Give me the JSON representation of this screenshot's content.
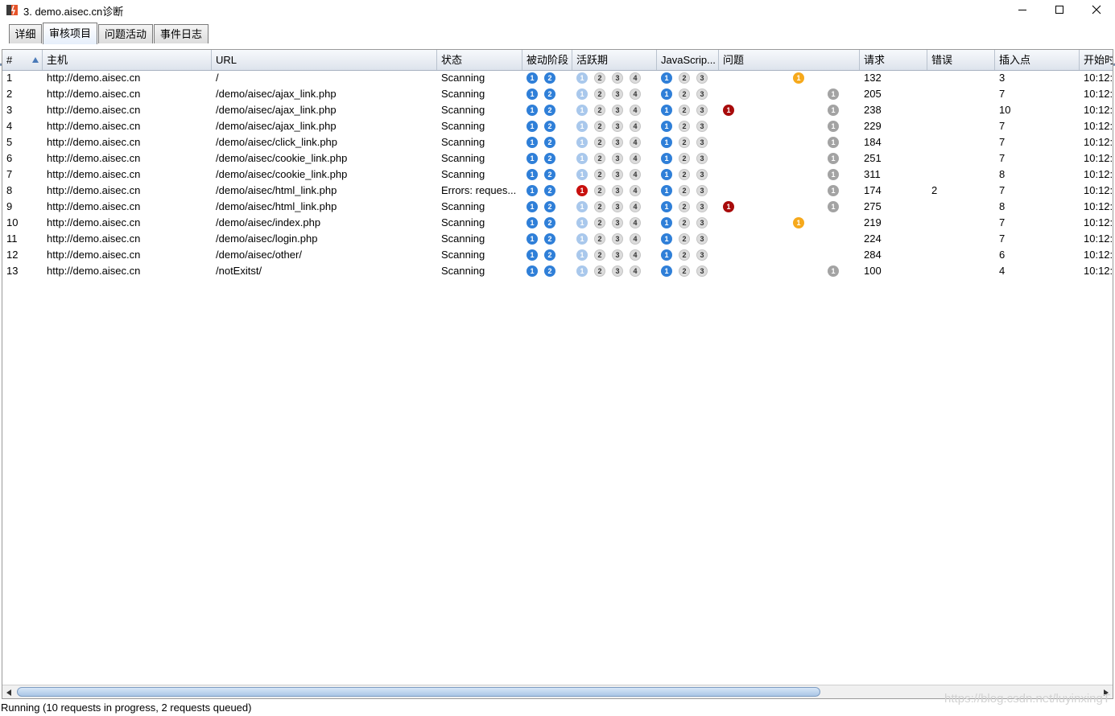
{
  "window": {
    "title": "3. demo.aisec.cn诊断"
  },
  "tabs": [
    {
      "label": "详细",
      "active": false
    },
    {
      "label": "审核项目",
      "active": true
    },
    {
      "label": "问题活动",
      "active": false
    },
    {
      "label": "事件日志",
      "active": false
    }
  ],
  "table": {
    "columns": [
      "#",
      "主机",
      "URL",
      "状态",
      "被动阶段",
      "活跃期",
      "JavaScrip...",
      "问题",
      "请求",
      "错误",
      "插入点",
      "开始时"
    ],
    "sort": {
      "column": "#",
      "direction": "ascending"
    },
    "rows": [
      {
        "id": "1",
        "host": "http://demo.aisec.cn",
        "url": "/",
        "status": "Scanning",
        "passive": [
          "blue",
          "blue"
        ],
        "active": [
          "light",
          "grey",
          "grey",
          "grey"
        ],
        "js": [
          "blue",
          "grey",
          "grey"
        ],
        "issues": [
          {
            "color": "orange",
            "count": "1",
            "slot": "mid"
          }
        ],
        "requests": "132",
        "errors": "",
        "insertion": "3",
        "start": "10:12:"
      },
      {
        "id": "2",
        "host": "http://demo.aisec.cn",
        "url": "/demo/aisec/ajax_link.php",
        "status": "Scanning",
        "passive": [
          "blue",
          "blue"
        ],
        "active": [
          "light",
          "grey",
          "grey",
          "grey"
        ],
        "js": [
          "blue",
          "grey",
          "grey"
        ],
        "issues": [
          {
            "color": "info",
            "count": "1",
            "slot": "right"
          }
        ],
        "requests": "205",
        "errors": "",
        "insertion": "7",
        "start": "10:12:"
      },
      {
        "id": "3",
        "host": "http://demo.aisec.cn",
        "url": "/demo/aisec/ajax_link.php",
        "status": "Scanning",
        "passive": [
          "blue",
          "blue"
        ],
        "active": [
          "light",
          "grey",
          "grey",
          "grey"
        ],
        "js": [
          "blue",
          "grey",
          "grey"
        ],
        "issues": [
          {
            "color": "dkred",
            "count": "1",
            "slot": "left"
          },
          {
            "color": "info",
            "count": "1",
            "slot": "right"
          }
        ],
        "requests": "238",
        "errors": "",
        "insertion": "10",
        "start": "10:12:"
      },
      {
        "id": "4",
        "host": "http://demo.aisec.cn",
        "url": "/demo/aisec/ajax_link.php",
        "status": "Scanning",
        "passive": [
          "blue",
          "blue"
        ],
        "active": [
          "light",
          "grey",
          "grey",
          "grey"
        ],
        "js": [
          "blue",
          "grey",
          "grey"
        ],
        "issues": [
          {
            "color": "info",
            "count": "1",
            "slot": "right"
          }
        ],
        "requests": "229",
        "errors": "",
        "insertion": "7",
        "start": "10:12:"
      },
      {
        "id": "5",
        "host": "http://demo.aisec.cn",
        "url": "/demo/aisec/click_link.php",
        "status": "Scanning",
        "passive": [
          "blue",
          "blue"
        ],
        "active": [
          "light",
          "grey",
          "grey",
          "grey"
        ],
        "js": [
          "blue",
          "grey",
          "grey"
        ],
        "issues": [
          {
            "color": "info",
            "count": "1",
            "slot": "right"
          }
        ],
        "requests": "184",
        "errors": "",
        "insertion": "7",
        "start": "10:12:"
      },
      {
        "id": "6",
        "host": "http://demo.aisec.cn",
        "url": "/demo/aisec/cookie_link.php",
        "status": "Scanning",
        "passive": [
          "blue",
          "blue"
        ],
        "active": [
          "light",
          "grey",
          "grey",
          "grey"
        ],
        "js": [
          "blue",
          "grey",
          "grey"
        ],
        "issues": [
          {
            "color": "info",
            "count": "1",
            "slot": "right"
          }
        ],
        "requests": "251",
        "errors": "",
        "insertion": "7",
        "start": "10:12:"
      },
      {
        "id": "7",
        "host": "http://demo.aisec.cn",
        "url": "/demo/aisec/cookie_link.php",
        "status": "Scanning",
        "passive": [
          "blue",
          "blue"
        ],
        "active": [
          "light",
          "grey",
          "grey",
          "grey"
        ],
        "js": [
          "blue",
          "grey",
          "grey"
        ],
        "issues": [
          {
            "color": "info",
            "count": "1",
            "slot": "right"
          }
        ],
        "requests": "311",
        "errors": "",
        "insertion": "8",
        "start": "10:12:"
      },
      {
        "id": "8",
        "host": "http://demo.aisec.cn",
        "url": "/demo/aisec/html_link.php",
        "status": "Errors: reques...",
        "passive": [
          "blue",
          "blue"
        ],
        "active": [
          "red",
          "grey",
          "grey",
          "grey"
        ],
        "js": [
          "blue",
          "grey",
          "grey"
        ],
        "issues": [
          {
            "color": "info",
            "count": "1",
            "slot": "right"
          }
        ],
        "requests": "174",
        "errors": "2",
        "insertion": "7",
        "start": "10:12:"
      },
      {
        "id": "9",
        "host": "http://demo.aisec.cn",
        "url": "/demo/aisec/html_link.php",
        "status": "Scanning",
        "passive": [
          "blue",
          "blue"
        ],
        "active": [
          "light",
          "grey",
          "grey",
          "grey"
        ],
        "js": [
          "blue",
          "grey",
          "grey"
        ],
        "issues": [
          {
            "color": "dkred",
            "count": "1",
            "slot": "left"
          },
          {
            "color": "info",
            "count": "1",
            "slot": "right"
          }
        ],
        "requests": "275",
        "errors": "",
        "insertion": "8",
        "start": "10:12:"
      },
      {
        "id": "10",
        "host": "http://demo.aisec.cn",
        "url": "/demo/aisec/index.php",
        "status": "Scanning",
        "passive": [
          "blue",
          "blue"
        ],
        "active": [
          "light",
          "grey",
          "grey",
          "grey"
        ],
        "js": [
          "blue",
          "grey",
          "grey"
        ],
        "issues": [
          {
            "color": "orange",
            "count": "1",
            "slot": "mid"
          }
        ],
        "requests": "219",
        "errors": "",
        "insertion": "7",
        "start": "10:12:"
      },
      {
        "id": "11",
        "host": "http://demo.aisec.cn",
        "url": "/demo/aisec/login.php",
        "status": "Scanning",
        "passive": [
          "blue",
          "blue"
        ],
        "active": [
          "light",
          "grey",
          "grey",
          "grey"
        ],
        "js": [
          "blue",
          "grey",
          "grey"
        ],
        "issues": [],
        "requests": "224",
        "errors": "",
        "insertion": "7",
        "start": "10:12:"
      },
      {
        "id": "12",
        "host": "http://demo.aisec.cn",
        "url": "/demo/aisec/other/",
        "status": "Scanning",
        "passive": [
          "blue",
          "blue"
        ],
        "active": [
          "light",
          "grey",
          "grey",
          "grey"
        ],
        "js": [
          "blue",
          "grey",
          "grey"
        ],
        "issues": [],
        "requests": "284",
        "errors": "",
        "insertion": "6",
        "start": "10:12:"
      },
      {
        "id": "13",
        "host": "http://demo.aisec.cn",
        "url": "/notExitst/",
        "status": "Scanning",
        "passive": [
          "blue",
          "blue"
        ],
        "active": [
          "light",
          "grey",
          "grey",
          "grey"
        ],
        "js": [
          "blue",
          "grey",
          "grey"
        ],
        "issues": [
          {
            "color": "info",
            "count": "1",
            "slot": "right"
          }
        ],
        "requests": "100",
        "errors": "",
        "insertion": "4",
        "start": "10:12:"
      }
    ]
  },
  "status_bar": {
    "text": "Running (10 requests in progress, 2 requests queued)"
  },
  "watermark": "https://blog.csdn.net/luyinxingT"
}
